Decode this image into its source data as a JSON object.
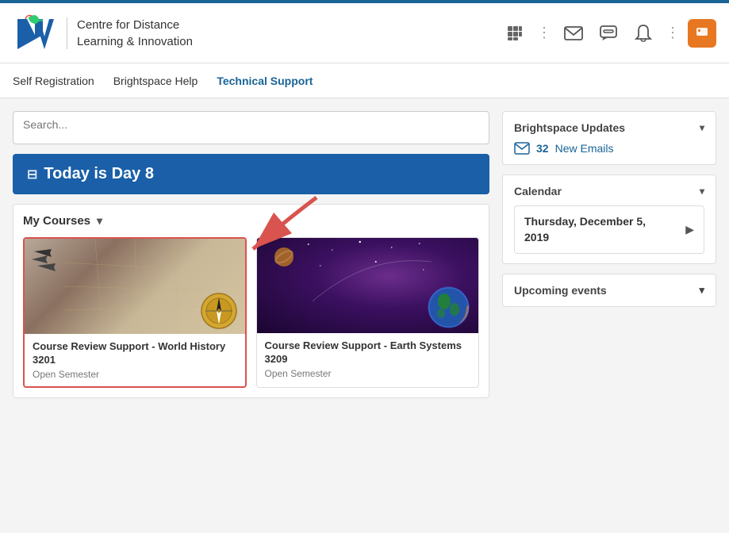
{
  "brand": {
    "logo_alt": "CDLI Logo",
    "name_line1": "Centre for Distance",
    "name_line2": "Learning & Innovation"
  },
  "topbar": {
    "apps_icon": "⊞",
    "email_icon": "✉",
    "chat_icon": "💬",
    "bell_icon": "🔔",
    "more_icon": "⋮",
    "user_icon": "▭"
  },
  "navbar": {
    "items": [
      {
        "label": "Self Registration",
        "active": false
      },
      {
        "label": "Brightspace Help",
        "active": false
      },
      {
        "label": "Technical Support",
        "active": true
      }
    ]
  },
  "search": {
    "placeholder": "Search..."
  },
  "today_banner": {
    "text": "Today is Day 8",
    "pin": "⊞"
  },
  "courses_section": {
    "header": "My Courses",
    "courses": [
      {
        "title": "Course Review Support - World History 3201",
        "subtitle": "Open Semester",
        "highlighted": true,
        "thumb_type": "history"
      },
      {
        "title": "Course Review Support - Earth Systems 3209",
        "subtitle": "Open Semester",
        "highlighted": false,
        "thumb_type": "space"
      }
    ]
  },
  "right_panel": {
    "updates": {
      "header": "Brightspace Updates",
      "email_count": "32",
      "email_label": "New Emails"
    },
    "calendar": {
      "header": "Calendar",
      "date_line1": "Thursday, December 5,",
      "date_line2": "2019"
    },
    "upcoming": {
      "header": "Upcoming events"
    }
  }
}
